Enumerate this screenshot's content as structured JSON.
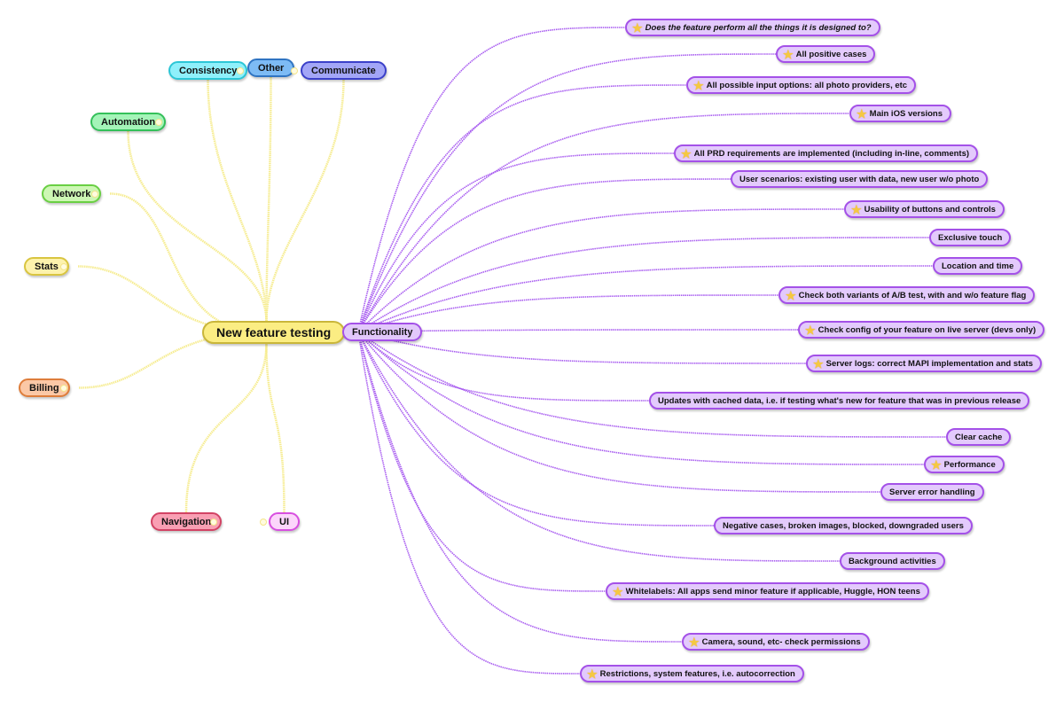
{
  "root": {
    "label": "New feature testing"
  },
  "branches": [
    {
      "id": "consistency",
      "label": "Consistency",
      "fill": "#8ff0fb",
      "border": "#2cc6d6"
    },
    {
      "id": "other",
      "label": "Other",
      "fill": "#7dbbf5",
      "border": "#2f74c2"
    },
    {
      "id": "communicate",
      "label": "Communicate",
      "fill": "#a3a6f7",
      "border": "#3b40c9"
    },
    {
      "id": "automation",
      "label": "Automation",
      "fill": "#a4f4b8",
      "border": "#34c05a"
    },
    {
      "id": "network",
      "label": "Network",
      "fill": "#cdf7b4",
      "border": "#69cf43"
    },
    {
      "id": "stats",
      "label": "Stats",
      "fill": "#fdf2ad",
      "border": "#d9c540"
    },
    {
      "id": "billing",
      "label": "Billing",
      "fill": "#fbc8a6",
      "border": "#de7d3b"
    },
    {
      "id": "navigation",
      "label": "Navigation",
      "fill": "#f99fb3",
      "border": "#d24364"
    },
    {
      "id": "ui",
      "label": "UI",
      "fill": "#fcd6fb",
      "border": "#d84fe0"
    }
  ],
  "functionality": {
    "label": "Functionality",
    "items": [
      {
        "label": "Does the feature perform all the things it is designed to?",
        "star": true,
        "italic": true
      },
      {
        "label": "All positive cases",
        "star": true
      },
      {
        "label": "All possible input options: all photo providers, etc",
        "star": true
      },
      {
        "label": "Main iOS versions",
        "star": true
      },
      {
        "label": "All PRD requirements are implemented (including in-line, comments)",
        "star": true
      },
      {
        "label": "User scenarios: existing user with data, new user w/o photo",
        "star": false
      },
      {
        "label": "Usability of buttons and controls",
        "star": true
      },
      {
        "label": "Exclusive touch",
        "star": false
      },
      {
        "label": "Location and time",
        "star": false
      },
      {
        "label": "Check both variants of A/B test, with and w/o feature flag",
        "star": true
      },
      {
        "label": "Check config of your feature on live server (devs only)",
        "star": true
      },
      {
        "label": "Server logs: correct MAPI implementation and stats",
        "star": true
      },
      {
        "label": "Updates with cached data, i.e. if testing what's new for feature that was in previous release",
        "star": false
      },
      {
        "label": "Clear cache",
        "star": false
      },
      {
        "label": "Performance",
        "star": true
      },
      {
        "label": "Server error handling",
        "star": false
      },
      {
        "label": "Negative cases, broken images, blocked, downgraded users",
        "star": false
      },
      {
        "label": "Background activities",
        "star": false
      },
      {
        "label": "Whitelabels: All apps send minor feature if applicable, Huggle, HON teens",
        "star": true
      },
      {
        "label": "Camera, sound, etc- check permissions",
        "star": true
      },
      {
        "label": "Restrictions, system features, i.e. autocorrection",
        "star": true
      }
    ]
  },
  "colors": {
    "root_link": "#f6ec8f",
    "func_link": "#a85cf0"
  }
}
